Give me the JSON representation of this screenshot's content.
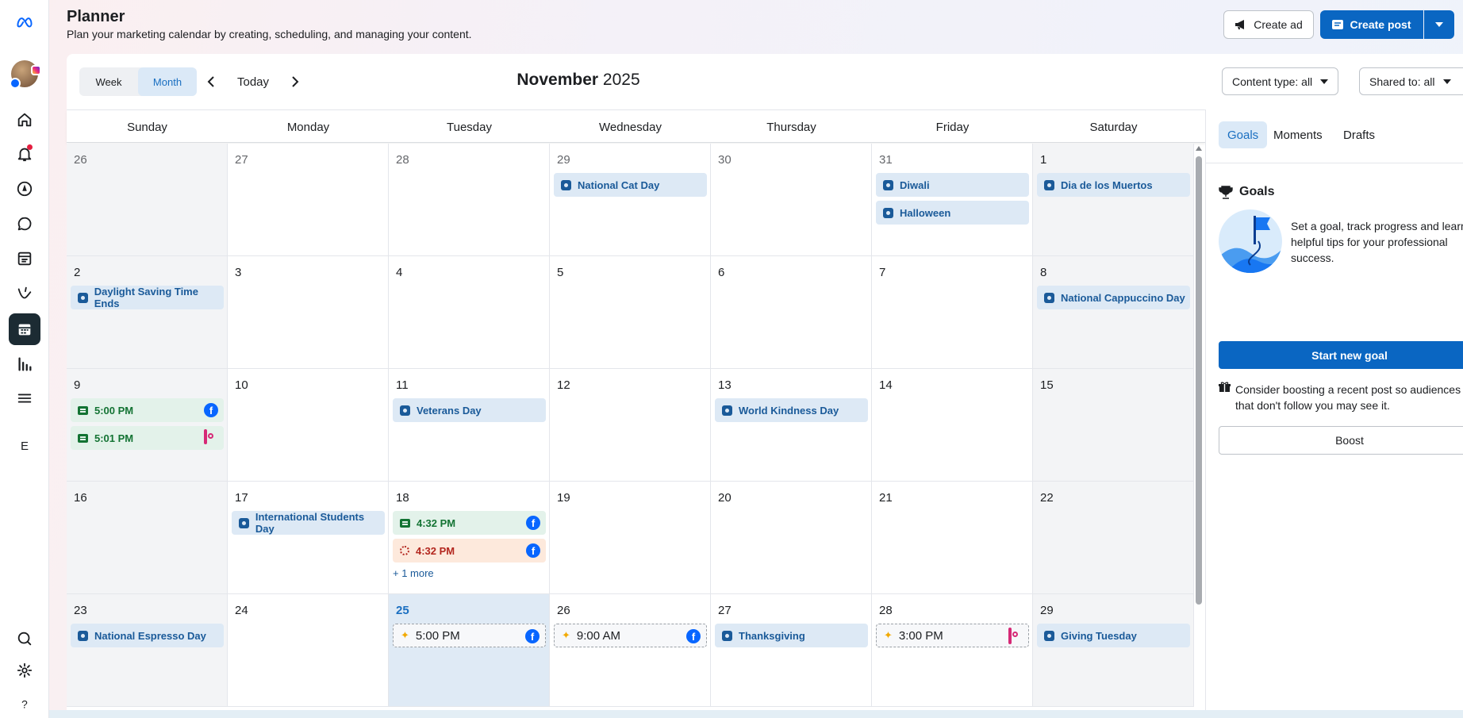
{
  "header": {
    "title": "Planner",
    "subtitle": "Plan your marketing calendar by creating, scheduling, and managing your content.",
    "create_ad": "Create ad",
    "create_post": "Create post"
  },
  "rail": {
    "letter": "E"
  },
  "toolbar": {
    "week": "Week",
    "month": "Month",
    "today": "Today",
    "month_name": "November",
    "year": "2025",
    "content_filter": "Content type: all",
    "shared_filter": "Shared to: all"
  },
  "weekdays": [
    "Sunday",
    "Monday",
    "Tuesday",
    "Wednesday",
    "Thursday",
    "Friday",
    "Saturday"
  ],
  "weeks": [
    [
      {
        "day": "26",
        "other": true,
        "events": []
      },
      {
        "day": "27",
        "other": true,
        "events": []
      },
      {
        "day": "28",
        "other": true,
        "events": []
      },
      {
        "day": "29",
        "other": true,
        "events": [
          {
            "type": "moment",
            "label": "National Cat Day"
          }
        ]
      },
      {
        "day": "30",
        "other": true,
        "events": []
      },
      {
        "day": "31",
        "other": true,
        "events": [
          {
            "type": "moment",
            "label": "Diwali"
          },
          {
            "type": "moment",
            "label": "Halloween"
          }
        ]
      },
      {
        "day": "1",
        "events": [
          {
            "type": "moment",
            "label": "Dia de los Muertos"
          }
        ]
      }
    ],
    [
      {
        "day": "2",
        "events": [
          {
            "type": "moment",
            "label": "Daylight Saving Time Ends"
          }
        ]
      },
      {
        "day": "3",
        "events": []
      },
      {
        "day": "4",
        "events": []
      },
      {
        "day": "5",
        "events": []
      },
      {
        "day": "6",
        "events": []
      },
      {
        "day": "7",
        "events": []
      },
      {
        "day": "8",
        "events": [
          {
            "type": "moment",
            "label": "National Cappuccino Day"
          }
        ]
      }
    ],
    [
      {
        "day": "9",
        "events": [
          {
            "type": "post",
            "label": "5:00 PM",
            "platform": "facebook"
          },
          {
            "type": "post",
            "label": "5:01 PM",
            "platform": "instagram"
          }
        ]
      },
      {
        "day": "10",
        "events": []
      },
      {
        "day": "11",
        "events": [
          {
            "type": "moment",
            "label": "Veterans Day"
          }
        ]
      },
      {
        "day": "12",
        "events": []
      },
      {
        "day": "13",
        "events": [
          {
            "type": "moment",
            "label": "World Kindness Day"
          }
        ]
      },
      {
        "day": "14",
        "events": []
      },
      {
        "day": "15",
        "events": []
      }
    ],
    [
      {
        "day": "16",
        "events": []
      },
      {
        "day": "17",
        "events": [
          {
            "type": "moment",
            "label": "International Students Day"
          }
        ]
      },
      {
        "day": "18",
        "events": [
          {
            "type": "post",
            "label": "4:32 PM",
            "platform": "facebook"
          },
          {
            "type": "draft",
            "label": "4:32 PM",
            "platform": "facebook"
          }
        ],
        "more": "+ 1 more"
      },
      {
        "day": "19",
        "events": []
      },
      {
        "day": "20",
        "events": []
      },
      {
        "day": "21",
        "events": []
      },
      {
        "day": "22",
        "events": []
      }
    ],
    [
      {
        "day": "23",
        "events": [
          {
            "type": "moment",
            "label": "National Espresso Day"
          }
        ]
      },
      {
        "day": "24",
        "events": []
      },
      {
        "day": "25",
        "today": true,
        "events": [
          {
            "type": "sched",
            "label": "5:00 PM",
            "platform": "facebook"
          }
        ]
      },
      {
        "day": "26",
        "events": [
          {
            "type": "sched",
            "label": "9:00 AM",
            "platform": "facebook"
          }
        ]
      },
      {
        "day": "27",
        "events": [
          {
            "type": "moment",
            "label": "Thanksgiving"
          }
        ]
      },
      {
        "day": "28",
        "events": [
          {
            "type": "sched",
            "label": "3:00 PM",
            "platform": "instagram"
          }
        ]
      },
      {
        "day": "29",
        "events": [
          {
            "type": "moment",
            "label": "Giving Tuesday"
          }
        ]
      }
    ]
  ],
  "side": {
    "tabs": [
      "Goals",
      "Moments",
      "Drafts"
    ],
    "goals_title": "Goals",
    "goal_line1": "Set a goal, track progress and learn",
    "goal_line2": "helpful tips for your professional",
    "goal_line3": "success.",
    "start_goal": "Start new goal",
    "boost_line1": "Consider boosting a recent post so audiences",
    "boost_line2": "that don't follow you may see it.",
    "boost": "Boost"
  },
  "colors": {
    "primary": "#0a66c2",
    "moment_bg": "#dde9f5",
    "post_bg": "#e3f2ea",
    "draft_bg": "#fde9dc",
    "today_bg": "#dfeaf5"
  }
}
